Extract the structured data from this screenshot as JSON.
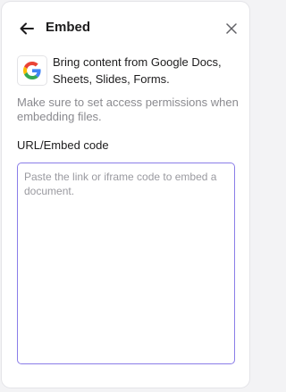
{
  "header": {
    "title": "Embed",
    "back_icon": "arrow-left-icon",
    "close_icon": "close-icon"
  },
  "provider": {
    "icon": "google-g-icon",
    "description": "Bring content from Google Docs, Sheets, Slides, Forms."
  },
  "note": "Make sure to set access permissions when embedding files.",
  "field": {
    "label": "URL/Embed code",
    "value": "",
    "placeholder": "Paste the link or iframe code to embed a document."
  },
  "colors": {
    "focus_border": "#8a7de8",
    "text": "#1d1c1d",
    "muted": "#8a8a8f"
  }
}
